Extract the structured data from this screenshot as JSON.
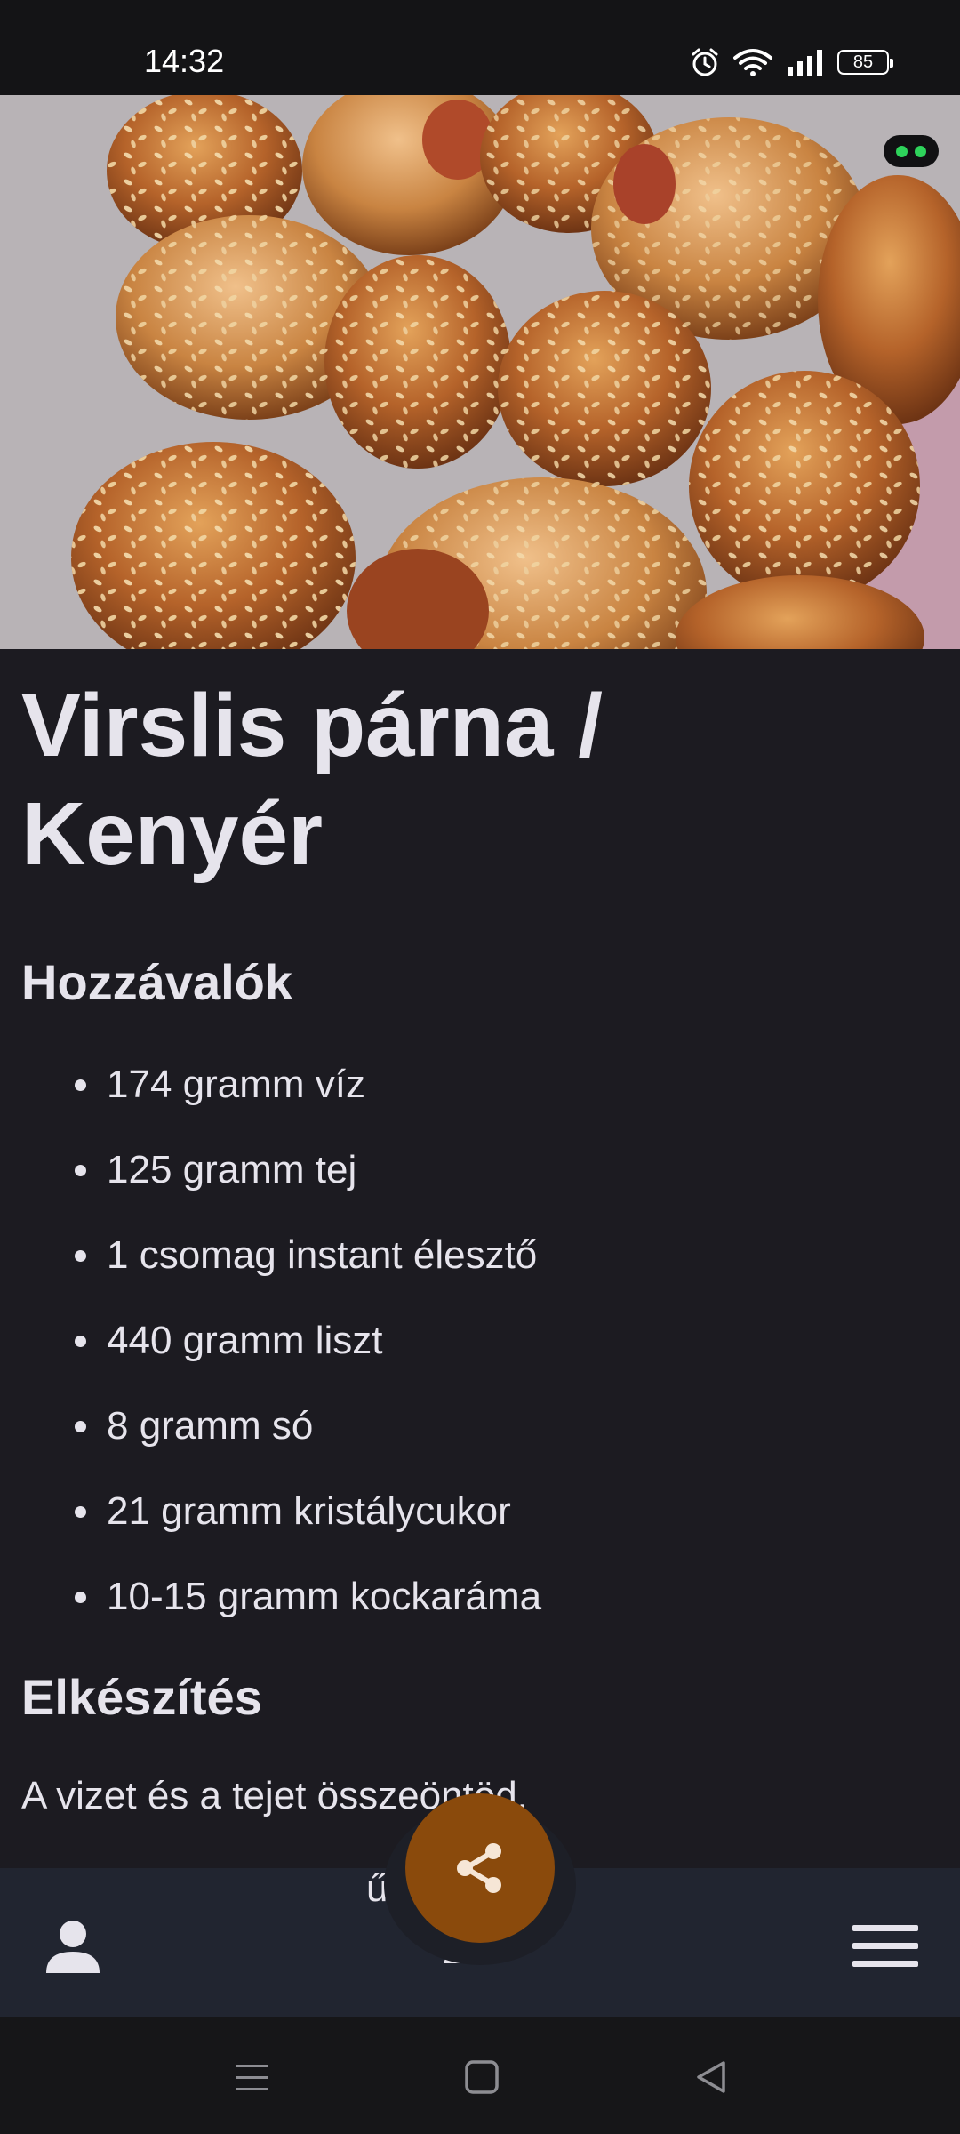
{
  "status_bar": {
    "time": "14:32",
    "battery_level": "85",
    "icons": [
      "alarm-icon",
      "wifi-icon",
      "signal-icon",
      "battery-icon"
    ]
  },
  "hero": {
    "image_subject": "baked sausage rolls with sesame seeds",
    "indicator": "camera-in-use-indicator",
    "indicator_color": "#2ed35b"
  },
  "recipe": {
    "title": "Virslis párna / Kenyér",
    "ingredients_heading": "Hozzávalók",
    "ingredients": [
      "174 gramm víz",
      "125 gramm tej",
      "1 csomag instant élesztő",
      "440 gramm liszt",
      "8 gramm só",
      "21 gramm kristálycukor",
      "10-15 gramm kockaráma"
    ],
    "method_heading": "Elkészítés",
    "method_first_line": "A vizet és a tejet összeöntöd."
  },
  "bottom_bar": {
    "peek_line_1": "űr zo",
    "peek_line_2": "ztő",
    "left_icon": "user-icon",
    "right_icon": "menu-icon",
    "fab_icon": "share-icon",
    "fab_color": "#8a4a0c"
  },
  "system_nav": {
    "buttons": [
      "recents-icon",
      "home-icon",
      "back-icon"
    ]
  },
  "colors": {
    "background": "#1c1b21",
    "text": "#e6e4ec",
    "bottom_bar": "#212530"
  }
}
